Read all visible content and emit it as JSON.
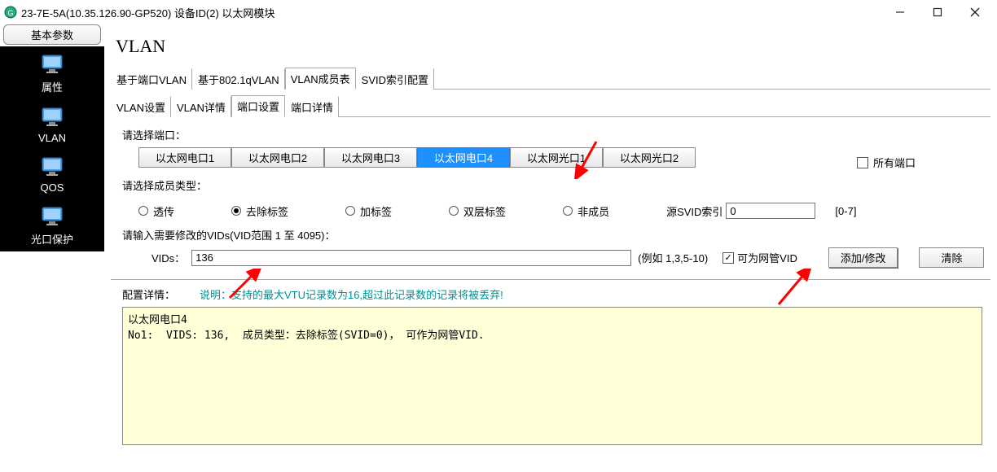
{
  "window": {
    "title": "23-7E-5A(10.35.126.90-GP520)  设备ID(2)  以太网模块"
  },
  "sidebar": {
    "header": "基本参数",
    "items": [
      {
        "label": "属性"
      },
      {
        "label": "VLAN"
      },
      {
        "label": "QOS"
      },
      {
        "label": "光口保护"
      }
    ]
  },
  "page": {
    "title": "VLAN",
    "tabs1": [
      {
        "label": "基于端口VLAN"
      },
      {
        "label": "基于802.1qVLAN"
      },
      {
        "label": "VLAN成员表",
        "active": true
      },
      {
        "label": "SVID索引配置"
      }
    ],
    "tabs2": [
      {
        "label": "VLAN设置"
      },
      {
        "label": "VLAN详情"
      },
      {
        "label": "端口设置",
        "active": true
      },
      {
        "label": "端口详情"
      }
    ],
    "select_port_label": "请选择端口：",
    "all_ports_label": "所有端口",
    "ports": [
      {
        "label": "以太网电口1"
      },
      {
        "label": "以太网电口2"
      },
      {
        "label": "以太网电口3"
      },
      {
        "label": "以太网电口4",
        "selected": true
      },
      {
        "label": "以太网光口1"
      },
      {
        "label": "以太网光口2"
      }
    ],
    "member_type_label": "请选择成员类型：",
    "member_types": [
      {
        "label": "透传"
      },
      {
        "label": "去除标签",
        "checked": true
      },
      {
        "label": "加标签"
      },
      {
        "label": "双层标签"
      },
      {
        "label": "非成员"
      }
    ],
    "svid_label": "源SVID索引",
    "svid_value": "0",
    "svid_range": "[0-7]",
    "vids_prompt": "请输入需要修改的VIDs(VID范围 1 至 4095)：",
    "vids_label": "VIDs：",
    "vids_value": "136",
    "vids_example": "(例如 1,3,5-10)",
    "mgmt_vid_label": "可为网管VID",
    "mgmt_vid_checked": true,
    "btn_add": "添加/修改",
    "btn_clear": "清除",
    "details_label": "配置详情：",
    "details_note": "说明：支持的最大VTU记录数为16,超过此记录数的记录将被丢弃!",
    "output_text": "以太网电口4\nNo1:  VIDS: 136,  成员类型：去除标签(SVID=0)， 可作为网管VID."
  }
}
